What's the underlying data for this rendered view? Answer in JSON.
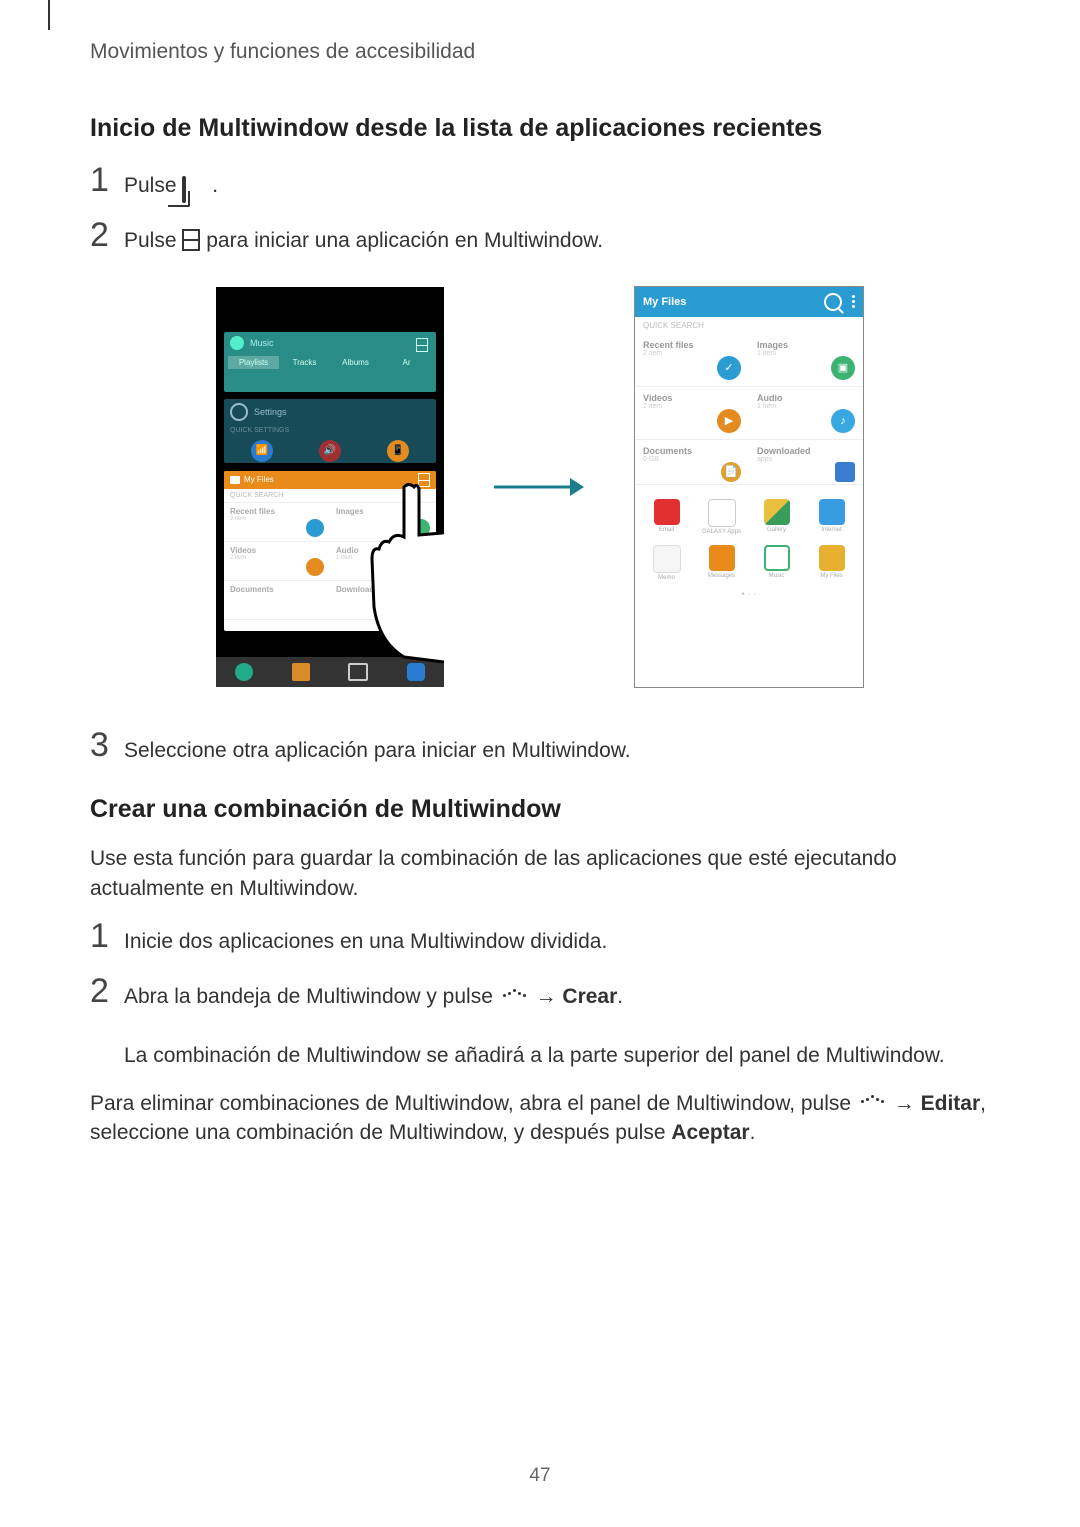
{
  "header": "Movimientos y funciones de accesibilidad",
  "section1": {
    "title": "Inicio de Multiwindow desde la lista de aplicaciones recientes",
    "steps": {
      "s1": {
        "num": "1",
        "text_pre": "Pulse ",
        "text_post": "."
      },
      "s2": {
        "num": "2",
        "text_pre": "Pulse ",
        "text_post": " para iniciar una aplicación en Multiwindow."
      },
      "s3": {
        "num": "3",
        "text": "Seleccione otra aplicación para iniciar en Multiwindow."
      }
    }
  },
  "section2": {
    "title": "Crear una combinación de Multiwindow",
    "intro": "Use esta función para guardar la combinación de las aplicaciones que esté ejecutando actualmente en Multiwindow.",
    "steps": {
      "s1": {
        "num": "1",
        "text": "Inicie dos aplicaciones en una Multiwindow dividida."
      },
      "s2": {
        "num": "2",
        "line1_pre": "Abra la bandeja de Multiwindow y pulse ",
        "line1_arrow": " → ",
        "line1_bold": "Crear",
        "line1_post": ".",
        "line2": "La combinación de Multiwindow se añadirá a la parte superior del panel de Multiwindow."
      }
    },
    "outro_pre": "Para eliminar combinaciones de Multiwindow, abra el panel de Multiwindow, pulse ",
    "outro_arrow": " → ",
    "outro_bold1": "Editar",
    "outro_mid": ", seleccione una combinación de Multiwindow, y después pulse ",
    "outro_bold2": "Aceptar",
    "outro_post": "."
  },
  "figure": {
    "left": {
      "music": {
        "label": "Music",
        "tab1": "Playlists",
        "tab2": "Tracks",
        "tab3": "Albums",
        "tab4": "Ar"
      },
      "settings": {
        "label": "Settings",
        "quick": "QUICK SETTINGS"
      },
      "files": {
        "title": "My Files",
        "quick": "QUICK SEARCH",
        "recent": "Recent files",
        "recent_sub": "2 item",
        "images": "Images",
        "images_sub": "",
        "videos": "Videos",
        "videos_sub": "2 item",
        "audio": "Audio",
        "audio_sub": "1 item",
        "documents": "Documents",
        "downloaded": "Downloaded"
      }
    },
    "right": {
      "title": "My Files",
      "quick": "QUICK SEARCH",
      "recent": "Recent files",
      "recent_sub": "2 item",
      "images": "Images",
      "images_sub": "1 item",
      "videos": "Videos",
      "videos_sub": "2 item",
      "audio": "Audio",
      "audio_sub": "1 item",
      "documents": "Documents",
      "documents_sub": "0 GB",
      "downloaded": "Downloaded",
      "downloaded_sub": "apps",
      "apps": {
        "email": "Email",
        "galaxy": "GALAXY Apps",
        "gallery": "Gallery",
        "internet": "Internet",
        "memo": "Memo",
        "messages": "Messages",
        "music": "Music",
        "myfiles": "My Files"
      }
    }
  },
  "page_number": "47"
}
